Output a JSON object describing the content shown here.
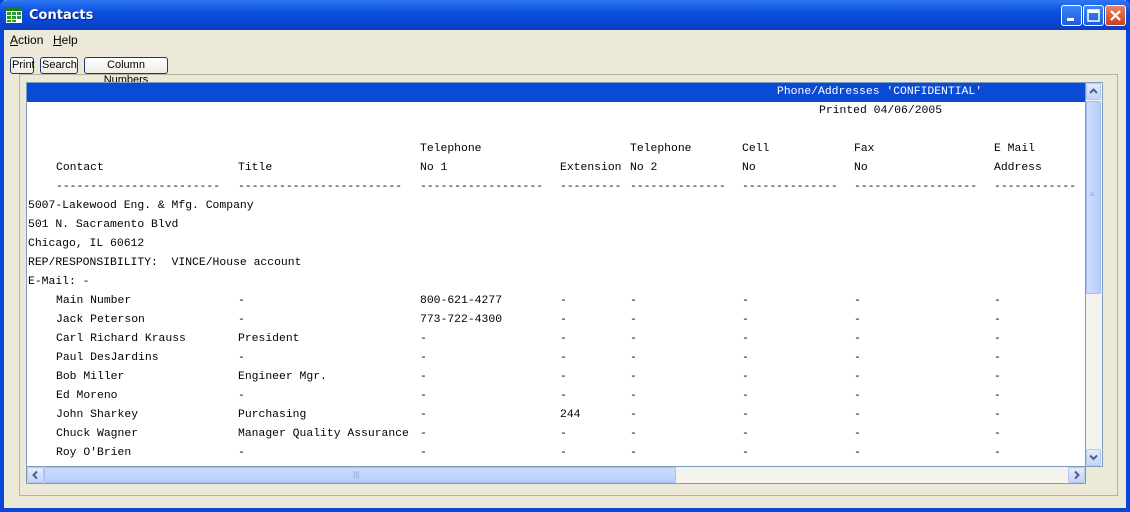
{
  "window": {
    "title": "Contacts"
  },
  "menu": [
    {
      "key": "A",
      "rest": "ction"
    },
    {
      "key": "H",
      "rest": "elp"
    }
  ],
  "toolbar": {
    "print_label": "Print",
    "search_label": "Search",
    "column_numbers_label": "Column Numbers"
  },
  "report": {
    "header_title": "Phone/Addresses 'CONFIDENTIAL'",
    "printed": "Printed 04/06/2005",
    "col_header_row1": [
      "",
      "",
      "Telephone",
      "",
      "Telephone",
      "Cell",
      "Fax",
      "E Mail"
    ],
    "col_header_row2": [
      "Contact",
      "Title",
      "No 1",
      "Extension",
      "No 2",
      "No",
      "No",
      "Address"
    ],
    "separators": [
      "------------------------",
      "------------------------",
      "------------------",
      "---------",
      "--------------",
      "--------------",
      "------------------",
      "------------"
    ],
    "company_lines": [
      "5007-Lakewood Eng. & Mfg. Company",
      "501 N. Sacramento Blvd",
      "Chicago, IL 60612",
      "REP/RESPONSIBILITY:  VINCE/House account",
      "E-Mail: -"
    ],
    "rows": [
      [
        "Main Number",
        "-",
        "800-621-4277",
        "-",
        "-",
        "-",
        "-",
        "-"
      ],
      [
        "Jack Peterson",
        "-",
        "773-722-4300",
        "-",
        "-",
        "-",
        "-",
        "-"
      ],
      [
        "Carl Richard Krauss",
        "President",
        "-",
        "-",
        "-",
        "-",
        "-",
        "-"
      ],
      [
        "Paul DesJardins",
        "-",
        "-",
        "-",
        "-",
        "-",
        "-",
        "-"
      ],
      [
        "Bob Miller",
        "Engineer Mgr.",
        "-",
        "-",
        "-",
        "-",
        "-",
        "-"
      ],
      [
        "Ed Moreno",
        "-",
        "-",
        "-",
        "-",
        "-",
        "-",
        "-"
      ],
      [
        "John Sharkey",
        "Purchasing",
        "-",
        "244",
        "-",
        "-",
        "-",
        "-"
      ],
      [
        "Chuck Wagner",
        "Manager Quality Assurance",
        "-",
        "-",
        "-",
        "-",
        "-",
        "-"
      ],
      [
        "Roy O'Brien",
        "-",
        "-",
        "-",
        "-",
        "-",
        "-",
        "-"
      ]
    ]
  },
  "colors": {
    "title_bar": "#0a50e0",
    "report_band": "#0a4bd6",
    "face": "#ece9d8"
  },
  "icons": {
    "app": "spreadsheet-icon",
    "minimize": "minimize-icon",
    "maximize": "maximize-icon",
    "close": "close-icon"
  }
}
